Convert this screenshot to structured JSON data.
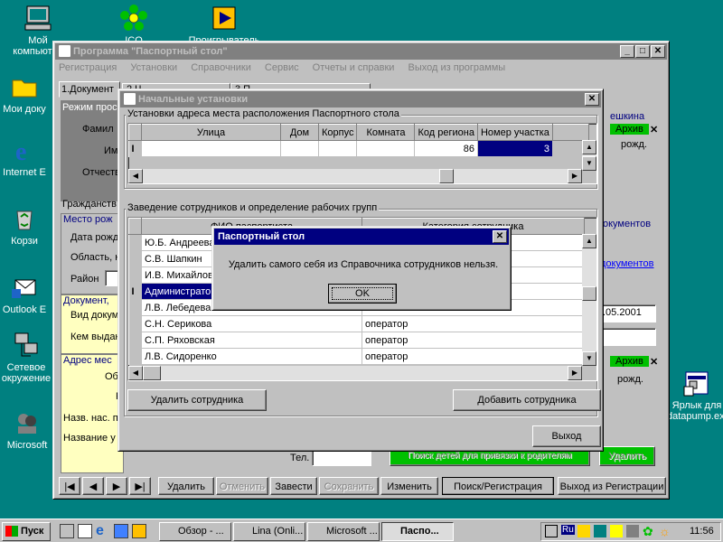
{
  "desktop_icons": [
    {
      "label": "Мой компьютер",
      "icon": "computer-icon"
    },
    {
      "label": "ICQ",
      "icon": "icq-icon"
    },
    {
      "label": "Проигрыватель",
      "icon": "player-icon"
    },
    {
      "label": "Мои доку",
      "icon": "folder-icon"
    },
    {
      "label": "Internet E",
      "icon": "ie-icon"
    },
    {
      "label": "Корзи",
      "icon": "recycle-bin-icon"
    },
    {
      "label": "Outlook E",
      "icon": "outlook-icon"
    },
    {
      "label": "Сетевое окружение",
      "icon": "network-icon"
    },
    {
      "label": "Microsoft",
      "icon": "msn-icon"
    },
    {
      "label": "Ярлык для datapump.exe",
      "icon": "shortcut-icon"
    }
  ],
  "main_window": {
    "title": "Программа \"Паспортный стол\"",
    "menu": [
      "Регистрация",
      "Установки",
      "Справочники",
      "Сервис",
      "Отчеты и справки",
      "Выход из программы"
    ],
    "tab_first": "1.Документ",
    "tab_other": [
      "2.Ч",
      "3.П"
    ],
    "section_mode": "Режим прос",
    "field_surname": "Фамил",
    "field_name": "Им",
    "field_patronymic": "Отчеств",
    "field_citizenship": "Гражданств",
    "section_birth": "Место рож",
    "field_birth_date": "Дата рожд",
    "field_region": "Область, н",
    "field_district": "Район",
    "section_document": "Документ,",
    "field_doc_type": "Вид докум",
    "field_issued_by": "Кем выдан",
    "section_address": "Адрес мес",
    "addr_region": "Об",
    "addr_r": "Р",
    "addr_settlement": "Назв. нас. п",
    "addr_street": "Название у",
    "addr_phone": "Тел.",
    "right_name": "ешкина",
    "right_archive": "Архив",
    "right_rozhd": "рожд.",
    "right_documents_1": "окументов",
    "right_documents_2": "документов",
    "right_date": ".05.2001",
    "right_archive_2": "Архив",
    "right_rozhd_2": "рожд.",
    "btn_search_children": "Поиск детей для привязки к родителям",
    "btn_delete_right": "Удалить",
    "bottom_buttons": [
      {
        "label": "Удалить",
        "disabled": false
      },
      {
        "label": "Отменить",
        "disabled": true
      },
      {
        "label": "Завести",
        "disabled": false
      },
      {
        "label": "Сохранить",
        "disabled": true
      },
      {
        "label": "Изменить",
        "disabled": false
      },
      {
        "label": "Поиск/Регистрация",
        "disabled": false
      },
      {
        "label": "Выход из Регистрации",
        "disabled": false
      }
    ]
  },
  "settings_window": {
    "title": "Начальные установки",
    "group_address": "Установки адреса места расположения Паспортного стола",
    "address_columns": [
      "Улица",
      "Дом",
      "Корпус",
      "Комната",
      "Код региона",
      "Номер участка"
    ],
    "address_row": {
      "street": "",
      "house": "",
      "block": "",
      "room": "",
      "region_code": "86",
      "district_number": "3"
    },
    "group_employees": "Заведение сотрудников и определение рабочих групп",
    "employee_columns": [
      "ФИО паспортиста",
      "Категория сотрудника"
    ],
    "employees": [
      {
        "name": "Ю.Б. Андреева",
        "category": ""
      },
      {
        "name": "С.В. Шапкин",
        "category": ""
      },
      {
        "name": "И.В. Михайлова",
        "category": ""
      },
      {
        "name": "Администратор",
        "category": ""
      },
      {
        "name": "Л.В. Лебедева",
        "category": ""
      },
      {
        "name": "С.Н. Серикова",
        "category": "оператор"
      },
      {
        "name": "С.П. Ряховская",
        "category": "оператор"
      },
      {
        "name": "Л.В. Сидоренко",
        "category": "оператор"
      }
    ],
    "btn_delete_employee": "Удалить сотрудника",
    "btn_add_employee": "Добавить сотрудника",
    "btn_exit": "Выход"
  },
  "message_box": {
    "title": "Паспортный стол",
    "message": "Удалить самого себя из Справочника сотрудников нельзя.",
    "ok": "OK"
  },
  "taskbar": {
    "start": "Пуск",
    "tasks": [
      "Обзор - ...",
      "Lina (Onli...",
      "Microsoft ...",
      "Паспо..."
    ],
    "language": "Ru",
    "clock": "11:56"
  }
}
